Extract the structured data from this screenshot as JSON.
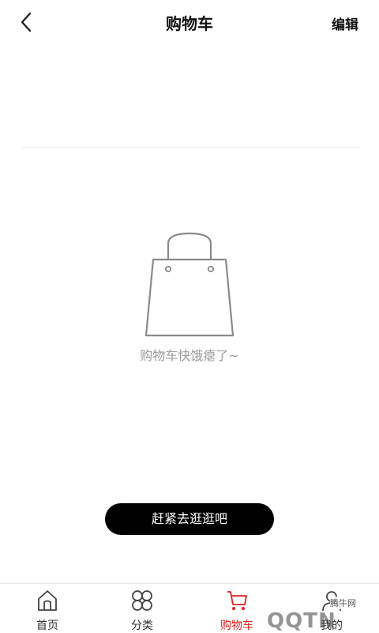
{
  "header": {
    "title": "购物车",
    "edit_label": "编辑"
  },
  "empty_state": {
    "message": "购物车快饿瘪了~",
    "icon": "shopping-bag-icon"
  },
  "cta": {
    "label": "赶紧去逛逛吧"
  },
  "tabbar": {
    "items": [
      {
        "label": "首页",
        "icon": "home-icon"
      },
      {
        "label": "分类",
        "icon": "category-icon"
      },
      {
        "label": "购物车",
        "icon": "cart-icon",
        "active": true
      },
      {
        "label": "我的",
        "icon": "user-icon"
      }
    ]
  },
  "watermark": {
    "text": "腾牛网",
    "logo": "QQTN"
  },
  "colors": {
    "accent": "#e02020",
    "button_bg": "#000000",
    "muted_text": "#9b9b9b"
  }
}
